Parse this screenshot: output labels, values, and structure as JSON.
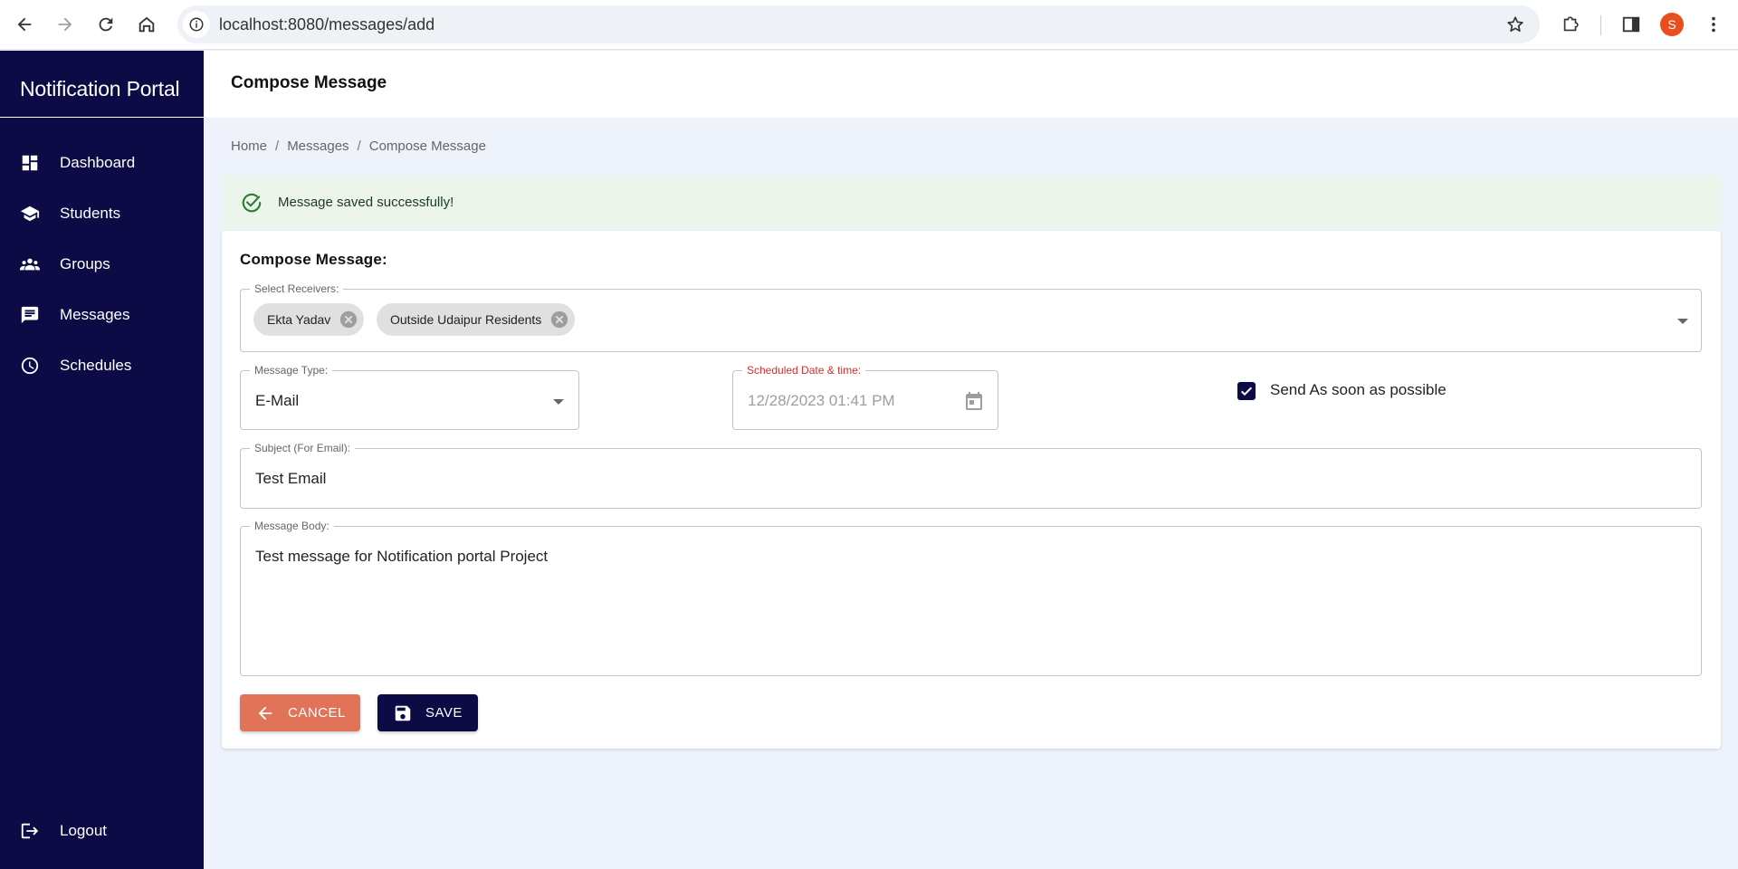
{
  "browser": {
    "url": "localhost:8080/messages/add",
    "profile_initial": "S"
  },
  "sidebar": {
    "brand": "Notification Portal",
    "items": [
      {
        "label": "Dashboard",
        "icon": "dashboard-icon"
      },
      {
        "label": "Students",
        "icon": "school-icon"
      },
      {
        "label": "Groups",
        "icon": "groups-icon"
      },
      {
        "label": "Messages",
        "icon": "chat-icon"
      },
      {
        "label": "Schedules",
        "icon": "clock-icon"
      }
    ],
    "logout": {
      "label": "Logout",
      "icon": "logout-icon"
    }
  },
  "header": {
    "title": "Compose Message"
  },
  "breadcrumb": [
    "Home",
    "Messages",
    "Compose Message"
  ],
  "alert": {
    "message": "Message saved successfully!",
    "status_color": "#2e7d32"
  },
  "form": {
    "title": "Compose Message:",
    "receivers": {
      "label": "Select Receivers:",
      "chips": [
        "Ekta Yadav",
        "Outside Udaipur Residents"
      ]
    },
    "message_type": {
      "label": "Message Type:",
      "value": "E-Mail"
    },
    "schedule": {
      "label": "Scheduled Date & time:",
      "value": "12/28/2023 01:41 PM",
      "label_color": "#d32f2f"
    },
    "asap": {
      "label": "Send As soon as possible",
      "checked": true
    },
    "subject": {
      "label": "Subject (For Email):",
      "value": "Test Email"
    },
    "body": {
      "label": "Message Body:",
      "value": "Test message for Notification portal Project"
    },
    "buttons": {
      "cancel": "CANCEL",
      "save": "SAVE"
    }
  },
  "colors": {
    "sidebar_bg": "#0c0b46",
    "cancel_bg": "#e07358",
    "save_bg": "#0c0b46",
    "page_bg": "#eef3fb"
  }
}
